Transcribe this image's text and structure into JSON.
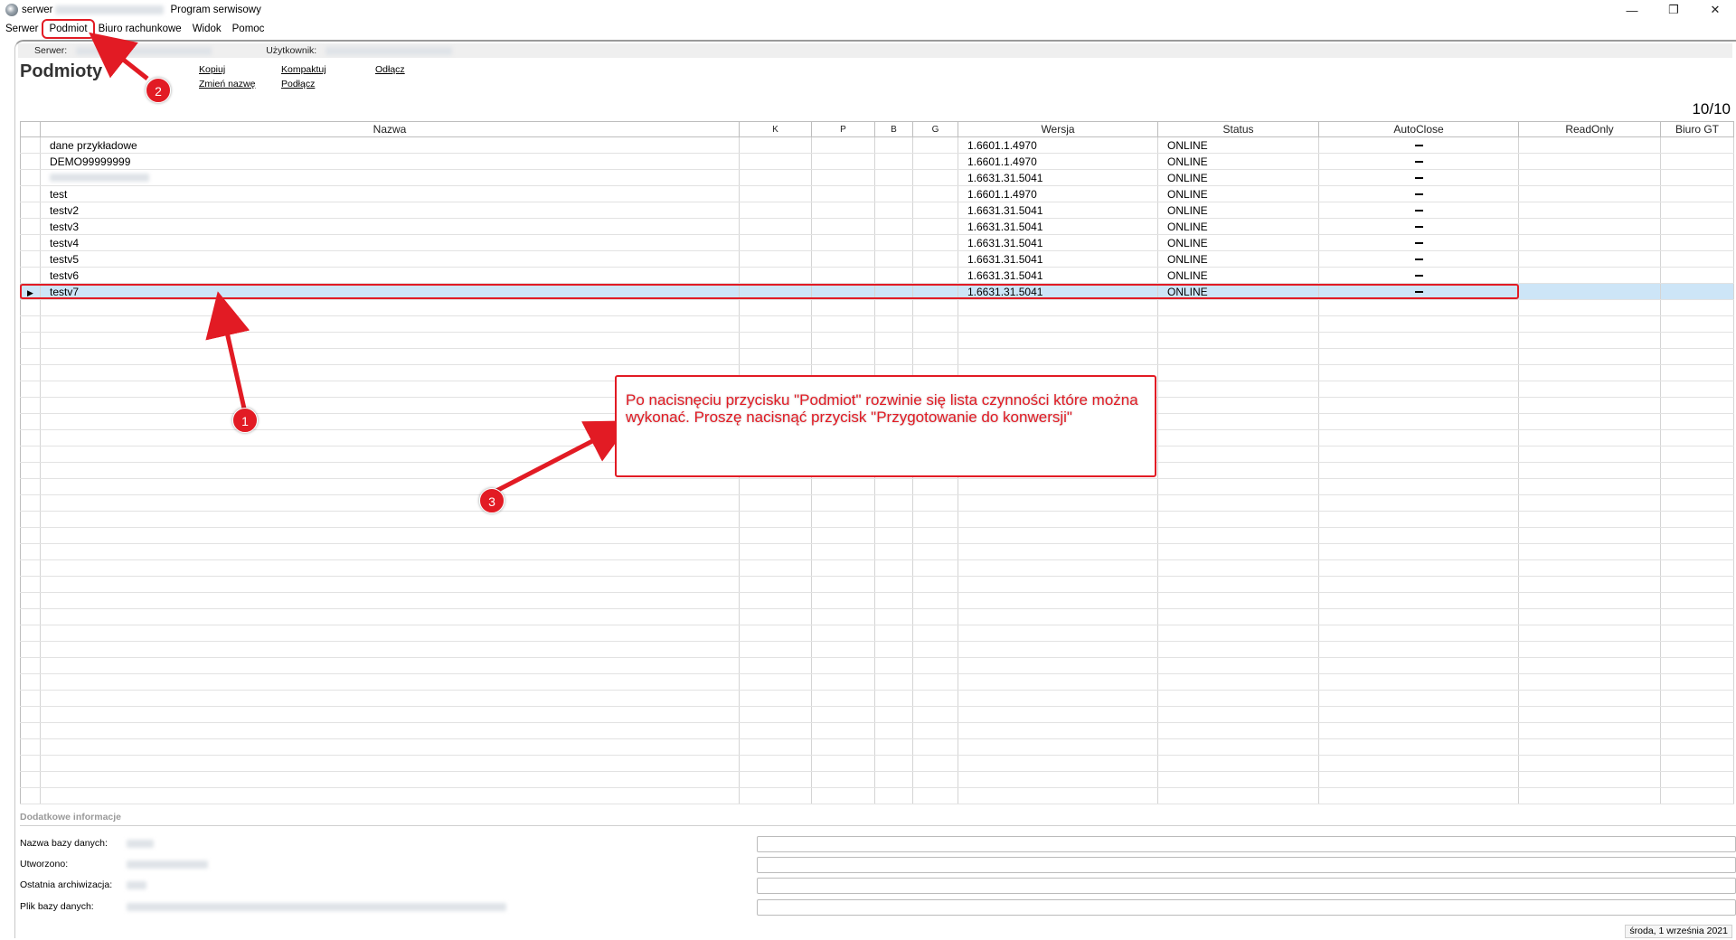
{
  "titlebar": {
    "prefix": "serwer",
    "title": "Program serwisowy",
    "minimize_glyph": "—",
    "restore_glyph": "❐",
    "close_glyph": "✕"
  },
  "menu": [
    "Serwer",
    "Podmiot",
    "Biuro rachunkowe",
    "Widok",
    "Pomoc"
  ],
  "infobar": {
    "server_label": "Serwer:",
    "user_label": "Użytkownik:"
  },
  "page_title": "Podmioty",
  "actions": {
    "copy": "Kopiuj",
    "rename": "Zmień nazwę",
    "compact": "Kompaktuj",
    "attach": "Podłącz",
    "detach": "Odłącz"
  },
  "record_count": "10/10",
  "table": {
    "headers": [
      "Nazwa",
      "K",
      "P",
      "B",
      "G",
      "Wersja",
      "Status",
      "AutoClose",
      "ReadOnly",
      "Biuro GT"
    ],
    "rows": [
      {
        "name": "dane przykładowe",
        "version": "1.6601.1.4970",
        "status": "ONLINE"
      },
      {
        "name": "DEMO99999999",
        "version": "1.6601.1.4970",
        "status": "ONLINE"
      },
      {
        "name": "",
        "version": "1.6631.31.5041",
        "status": "ONLINE"
      },
      {
        "name": "test",
        "version": "1.6601.1.4970",
        "status": "ONLINE"
      },
      {
        "name": "testv2",
        "version": "1.6631.31.5041",
        "status": "ONLINE"
      },
      {
        "name": "testv3",
        "version": "1.6631.31.5041",
        "status": "ONLINE"
      },
      {
        "name": "testv4",
        "version": "1.6631.31.5041",
        "status": "ONLINE"
      },
      {
        "name": "testv5",
        "version": "1.6631.31.5041",
        "status": "ONLINE"
      },
      {
        "name": "testv6",
        "version": "1.6631.31.5041",
        "status": "ONLINE"
      },
      {
        "name": "testv7",
        "version": "1.6631.31.5041",
        "status": "ONLINE"
      }
    ],
    "selected_row_index": 9,
    "selected_marker": "▶"
  },
  "annotation": {
    "text": "Po nacisnęciu przycisku \"Podmiot\" rozwinie się lista czynności które można wykonać. Proszę nacisnąć przycisk \"Przygotowanie do konwersji\"",
    "badges": [
      "1",
      "2",
      "3"
    ],
    "color": "#e21b24"
  },
  "extra_info": {
    "header": "Dodatkowe informacje",
    "fields": [
      "Nazwa bazy danych:",
      "Utworzono:",
      "Ostatnia archiwizacja:",
      "Plik bazy danych:"
    ]
  },
  "statusbar": {
    "date": "środa, 1 września 2021"
  }
}
